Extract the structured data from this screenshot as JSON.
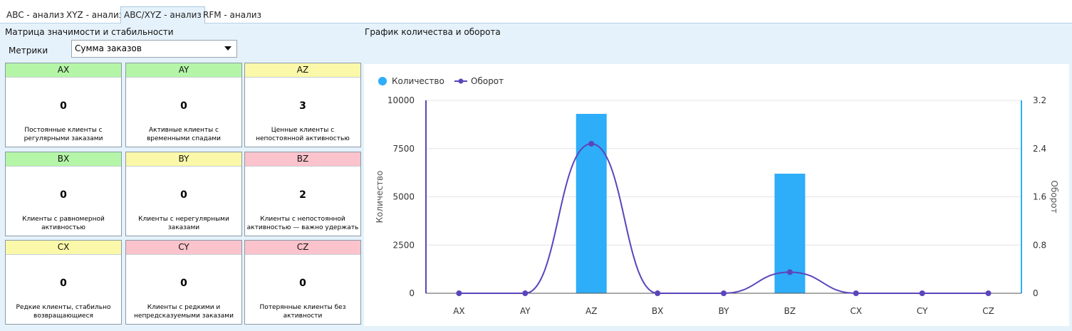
{
  "tabs": [
    {
      "label": "ABC - анализ",
      "active": false
    },
    {
      "label": "XYZ - анализ",
      "active": false
    },
    {
      "label": "ABC/XYZ - анализ",
      "active": true
    },
    {
      "label": "RFM - анализ",
      "active": false
    }
  ],
  "matrix": {
    "title": "Матрица значимости и стабильности",
    "metric_label": "Метрики",
    "metric_value": "Сумма заказов",
    "cells": [
      {
        "code": "AX",
        "color": "green",
        "value": "0",
        "desc": "Постоянные клиенты с регулярными заказами"
      },
      {
        "code": "AY",
        "color": "green",
        "value": "0",
        "desc": "Активные клиенты с временными спадами"
      },
      {
        "code": "AZ",
        "color": "yellow",
        "value": "3",
        "desc": "Ценные клиенты с непостоянной активностью"
      },
      {
        "code": "BX",
        "color": "green",
        "value": "0",
        "desc": "Клиенты с равномерной активностью"
      },
      {
        "code": "BY",
        "color": "yellow",
        "value": "0",
        "desc": "Клиенты с нерегулярными заказами"
      },
      {
        "code": "BZ",
        "color": "red",
        "value": "2",
        "desc": "Клиенты с непостоянной активностью — важно удержать"
      },
      {
        "code": "CX",
        "color": "yellow",
        "value": "0",
        "desc": "Редкие клиенты, стабильно возвращающиеся"
      },
      {
        "code": "CY",
        "color": "red",
        "value": "0",
        "desc": "Клиенты с редкими и непредсказуемыми заказами"
      },
      {
        "code": "CZ",
        "color": "red",
        "value": "0",
        "desc": "Потерянные клиенты без активности"
      }
    ]
  },
  "chart_title": "График количества и оборота",
  "chart_data": {
    "type": "bar",
    "categories": [
      "AX",
      "AY",
      "AZ",
      "BX",
      "BY",
      "BZ",
      "CX",
      "CY",
      "CZ"
    ],
    "series": [
      {
        "name": "Количество",
        "kind": "bar",
        "axis": "left",
        "color": "#2eadf8",
        "values": [
          0,
          0,
          9300,
          0,
          0,
          6200,
          0,
          0,
          0
        ]
      },
      {
        "name": "Оборот",
        "kind": "line",
        "axis": "right",
        "color": "#5b45bb",
        "values": [
          0,
          0,
          2.48,
          0,
          0,
          0.35,
          0,
          0,
          0
        ]
      }
    ],
    "ylabel": "Количество",
    "y2label": "Оборот",
    "ylim": [
      0,
      10000
    ],
    "y2lim": [
      0,
      3.2
    ],
    "yticks": [
      "0",
      "2500",
      "5000",
      "7500",
      "10000"
    ],
    "y2ticks": [
      "0",
      "0.8",
      "1.6",
      "2.4",
      "3.2"
    ],
    "grid": true,
    "legend": "top-left"
  }
}
